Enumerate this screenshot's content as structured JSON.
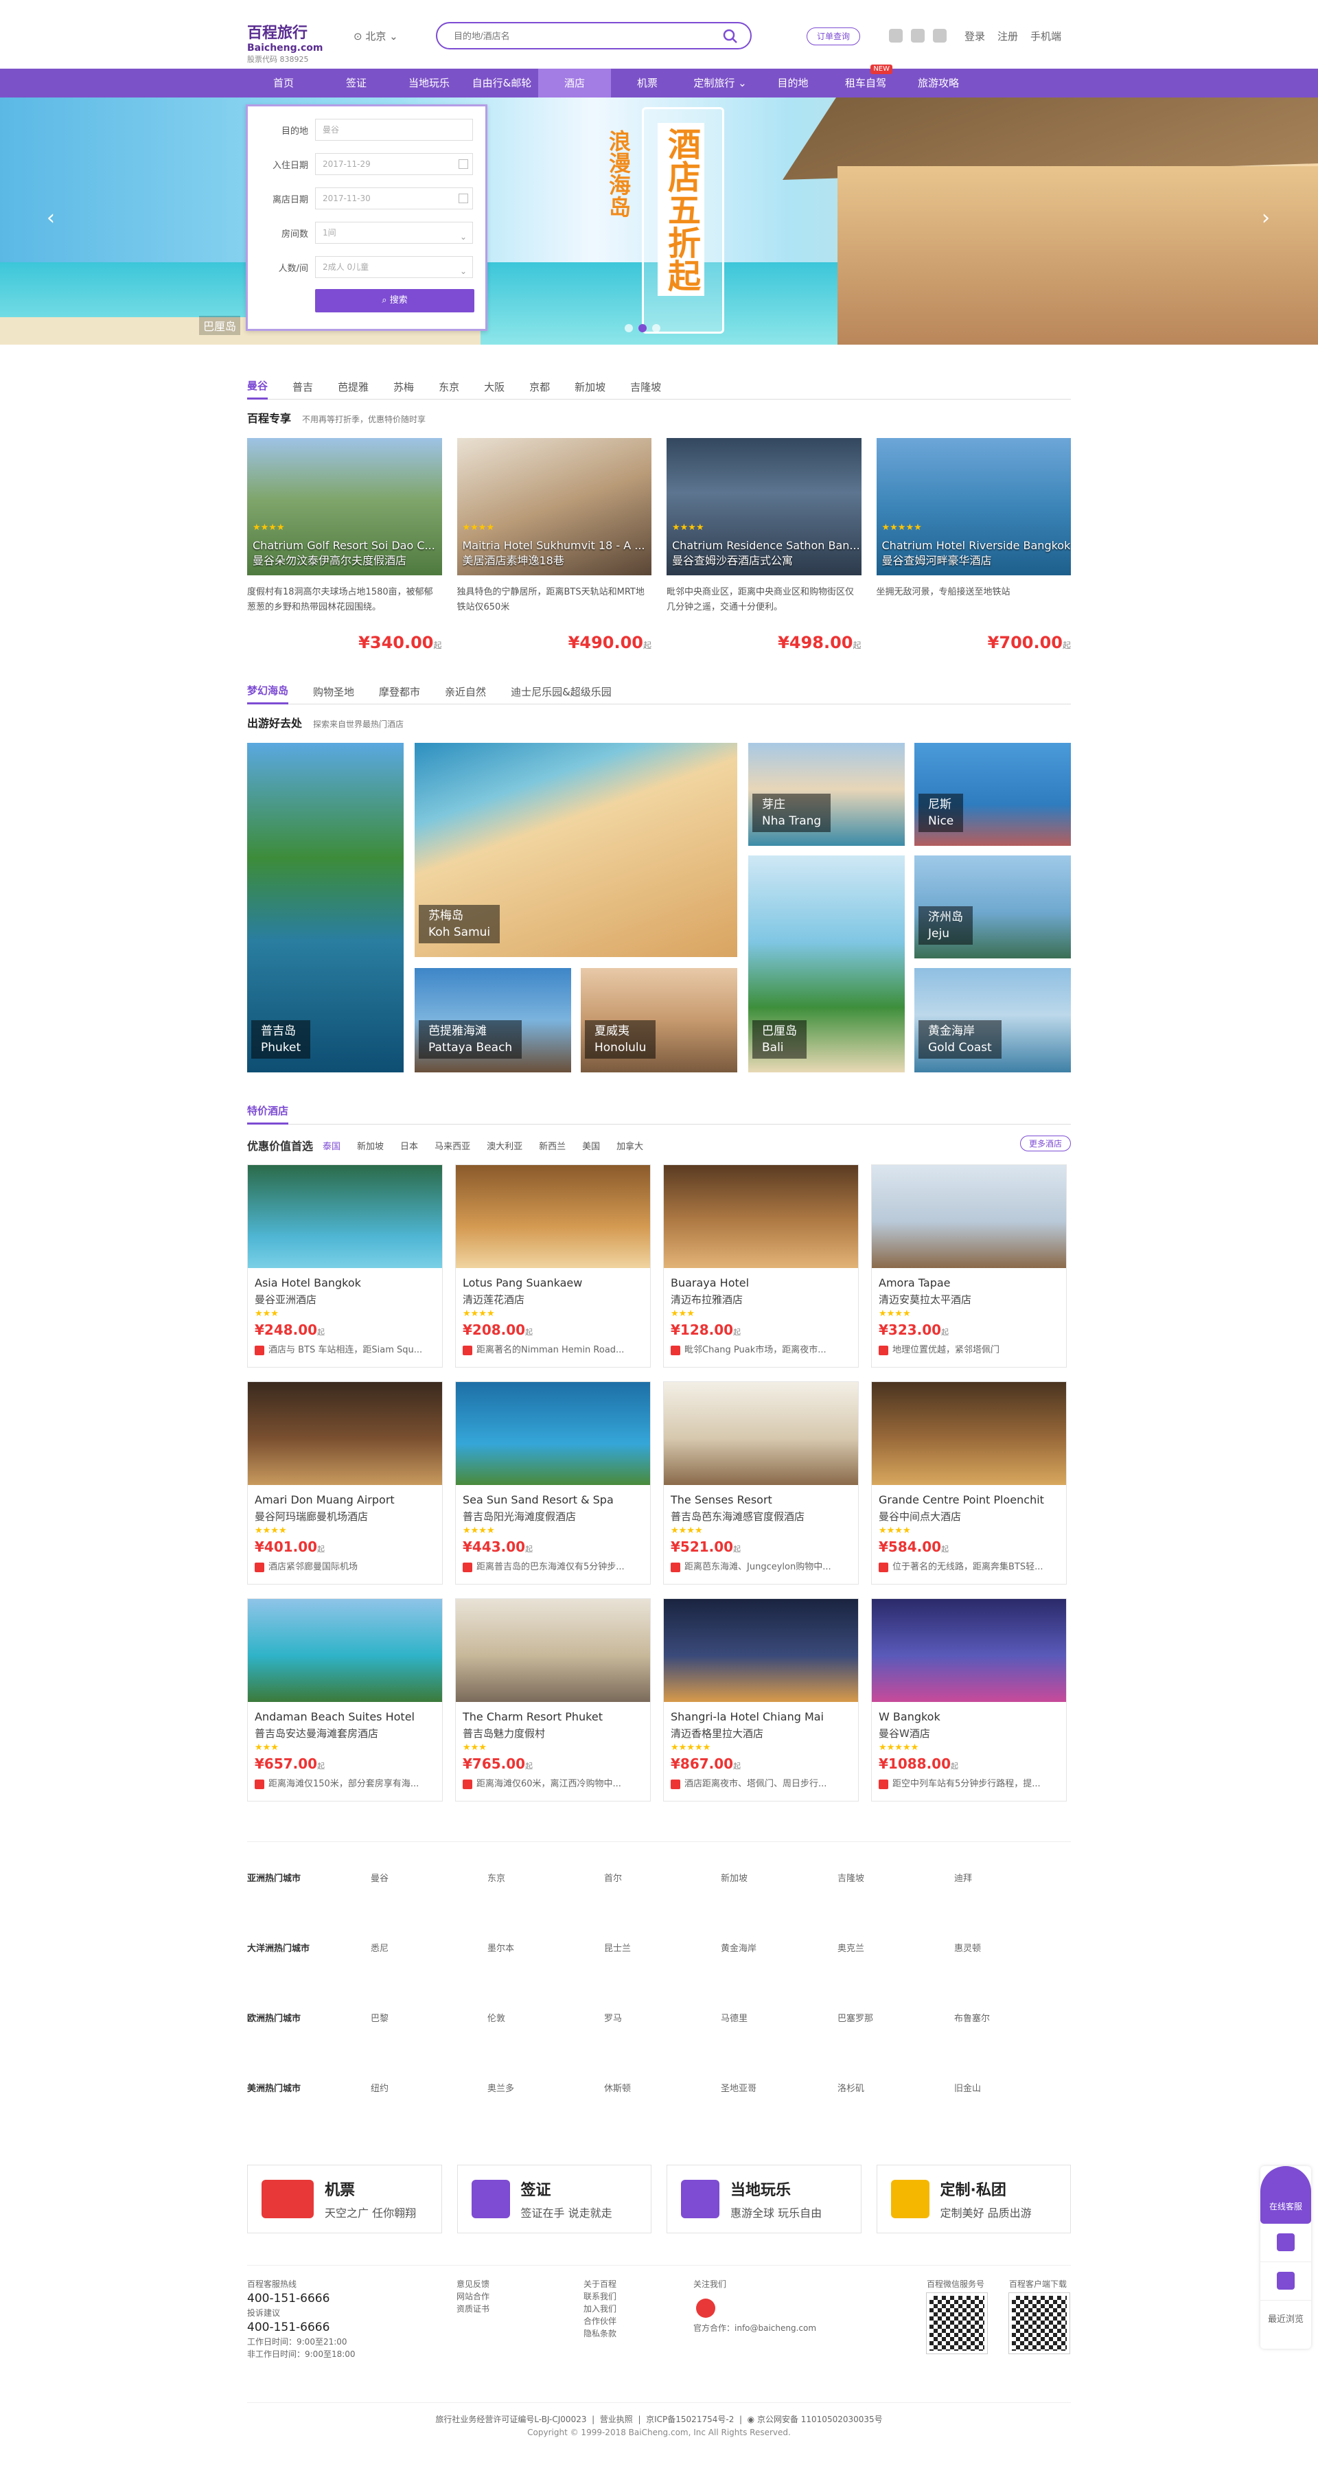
{
  "header": {
    "logo_cn": "百程旅行",
    "logo_en": "Baicheng.com",
    "logo_stock": "股票代码 838925",
    "city": "北京",
    "search_placeholder": "目的地/酒店名",
    "order_query": "订单查询",
    "links": [
      "登录",
      "注册",
      "手机端"
    ]
  },
  "nav": [
    "首页",
    "签证",
    "当地玩乐",
    "自由行&邮轮",
    "酒店",
    "机票",
    "定制旅行",
    "目的地",
    "租车自驾",
    "旅游攻略"
  ],
  "nav_new_tag": "NEW",
  "banner": {
    "slogan": "巴厘岛",
    "poster_small": "浪漫海岛",
    "poster_big": "酒店五折起"
  },
  "booking": {
    "dest_label": "目的地",
    "dest_value": "曼谷",
    "checkin_label": "入住日期",
    "checkin_value": "2017-11-29",
    "checkout_label": "离店日期",
    "checkout_value": "2017-11-30",
    "rooms_label": "房间数",
    "rooms_value": "1间",
    "guests_label": "人数/间",
    "guests_value": "2成人 0儿童",
    "search_btn": "搜索"
  },
  "exclusive": {
    "tabs": [
      "曼谷",
      "普吉",
      "芭提雅",
      "苏梅",
      "东京",
      "大阪",
      "京都",
      "新加坡",
      "吉隆坡"
    ],
    "title": "百程专享",
    "desc": "不用再等打折季，优惠特价随时享",
    "cards": [
      {
        "en": "Chatrium Golf Resort Soi Dao C...",
        "cn": "曼谷朵勿汶泰伊高尔夫度假酒店",
        "desc": "度假村有18洞高尔夫球场占地1580亩，被郁郁葱葱的乡野和热带园林花园围绕。",
        "price": "¥340.00",
        "stars": "★★★★"
      },
      {
        "en": "Maitria Hotel Sukhumvit 18 - A ...",
        "cn": "美居酒店素坤逸18巷",
        "desc": "独具特色的宁静居所，距离BTS天轨站和MRT地铁站仅650米",
        "price": "¥490.00",
        "stars": "★★★★"
      },
      {
        "en": "Chatrium Residence Sathon Ban...",
        "cn": "曼谷查姆沙吞酒店式公寓",
        "desc": "毗邻中央商业区，距离中央商业区和购物街区仅几分钟之遥，交通十分便利。",
        "price": "¥498.00",
        "stars": "★★★★"
      },
      {
        "en": "Chatrium Hotel Riverside Bangkok",
        "cn": "曼谷查姆河畔豪华酒店",
        "desc": "坐拥无敌河景，专船接送至地铁站",
        "price": "¥700.00",
        "stars": "★★★★★"
      }
    ],
    "price_suffix": "起"
  },
  "islands": {
    "tabs": [
      "梦幻海岛",
      "购物圣地",
      "摩登都市",
      "亲近自然",
      "迪士尼乐园&超级乐园"
    ],
    "title": "出游好去处",
    "desc": "探索来自世界最热门酒店",
    "tiles": [
      {
        "cn": "普吉岛",
        "en": "Phuket"
      },
      {
        "cn": "苏梅岛",
        "en": "Koh Samui"
      },
      {
        "cn": "芽庄",
        "en": "Nha Trang"
      },
      {
        "cn": "尼斯",
        "en": "Nice"
      },
      {
        "cn": "巴厘岛",
        "en": "Bali"
      },
      {
        "cn": "济州岛",
        "en": "Jeju"
      },
      {
        "cn": "芭提雅海滩",
        "en": "Pattaya Beach"
      },
      {
        "cn": "夏威夷",
        "en": "Honolulu"
      },
      {
        "cn": "黄金海岸",
        "en": "Gold Coast"
      }
    ]
  },
  "deals": {
    "section_title": "特价酒店",
    "filter_title": "优惠价值首选",
    "countries": [
      "泰国",
      "新加坡",
      "日本",
      "马来西亚",
      "澳大利亚",
      "新西兰",
      "美国",
      "加拿大"
    ],
    "more": "更多酒店",
    "price_suffix": "起",
    "hotels": [
      {
        "en": "Asia Hotel Bangkok",
        "cn": "曼谷亚洲酒店",
        "stars": "★★★",
        "price": "¥248.00",
        "note": "酒店与 BTS 车站相连，距Siam Squ..."
      },
      {
        "en": "Lotus Pang Suankaew",
        "cn": "清迈莲花酒店",
        "stars": "★★★★",
        "price": "¥208.00",
        "note": "距离著名的Nimman Hemin Road..."
      },
      {
        "en": "Buaraya Hotel",
        "cn": "清迈布拉雅酒店",
        "stars": "★★★",
        "price": "¥128.00",
        "note": "毗邻Chang Puak市场，距离夜市..."
      },
      {
        "en": "Amora Tapae",
        "cn": "清迈安莫拉太平酒店",
        "stars": "★★★★",
        "price": "¥323.00",
        "note": "地理位置优越，紧邻塔佩门"
      },
      {
        "en": "Amari Don Muang Airport",
        "cn": "曼谷阿玛瑞廊曼机场酒店",
        "stars": "★★★★",
        "price": "¥401.00",
        "note": "酒店紧邻廊曼国际机场"
      },
      {
        "en": "Sea Sun Sand Resort & Spa",
        "cn": "普吉岛阳光海滩度假酒店",
        "stars": "★★★★",
        "price": "¥443.00",
        "note": "距离普吉岛的巴东海滩仅有5分钟步..."
      },
      {
        "en": "The Senses Resort",
        "cn": "普吉岛芭东海滩感官度假酒店",
        "stars": "★★★★",
        "price": "¥521.00",
        "note": "距离芭东海滩、Jungceylon购物中..."
      },
      {
        "en": "Grande Centre Point Ploenchit",
        "cn": "曼谷中间点大酒店",
        "stars": "★★★★",
        "price": "¥584.00",
        "note": "位于著名的无线路，距离奔集BTS轻..."
      },
      {
        "en": "Andaman Beach Suites Hotel",
        "cn": "普吉岛安达曼海滩套房酒店",
        "stars": "★★★",
        "price": "¥657.00",
        "note": "距离海滩仅150米，部分套房享有海..."
      },
      {
        "en": "The Charm Resort Phuket",
        "cn": "普吉岛魅力度假村",
        "stars": "★★★",
        "price": "¥765.00",
        "note": "距离海滩仅60米，离江西冷购物中..."
      },
      {
        "en": "Shangri-la Hotel Chiang Mai",
        "cn": "清迈香格里拉大酒店",
        "stars": "★★★★★",
        "price": "¥867.00",
        "note": "酒店距离夜市、塔佩门、周日步行..."
      },
      {
        "en": "W Bangkok",
        "cn": "曼谷W酒店",
        "stars": "★★★★★",
        "price": "¥1088.00",
        "note": "距空中列车站有5分钟步行路程，提..."
      }
    ]
  },
  "hot_cities": [
    {
      "region": "亚洲热门城市",
      "cities": [
        "曼谷",
        "东京",
        "首尔",
        "新加坡",
        "吉隆坡",
        "迪拜"
      ]
    },
    {
      "region": "大洋洲热门城市",
      "cities": [
        "悉尼",
        "墨尔本",
        "昆士兰",
        "黄金海岸",
        "奥克兰",
        "惠灵顿"
      ]
    },
    {
      "region": "欧洲热门城市",
      "cities": [
        "巴黎",
        "伦敦",
        "罗马",
        "马德里",
        "巴塞罗那",
        "布鲁塞尔"
      ]
    },
    {
      "region": "美洲热门城市",
      "cities": [
        "纽约",
        "奥兰多",
        "休斯顿",
        "圣地亚哥",
        "洛杉矶",
        "旧金山"
      ]
    }
  ],
  "services": [
    {
      "title": "机票",
      "sub": "天空之广 任你翱翔",
      "color": "#e83838"
    },
    {
      "title": "签证",
      "sub": "签证在手 说走就走",
      "color": "#7d4cd3"
    },
    {
      "title": "当地玩乐",
      "sub": "惠游全球 玩乐自由",
      "color": "#7d4cd3"
    },
    {
      "title": "定制·私团",
      "sub": "定制美好 品质出游",
      "color": "#f5b700"
    }
  ],
  "footer": {
    "hotline_label": "百程客服热线",
    "hotline": "400-151-6666",
    "complaint_label": "投诉建议",
    "complaint": "400-151-6666",
    "hours1": "工作日时间：9:00至21:00",
    "hours2": "非工作日时间：9:00至18:00",
    "col2": [
      "意见反馈",
      "网站合作",
      "资质证书"
    ],
    "col3": [
      "关于百程",
      "联系我们",
      "加入我们",
      "合作伙伴",
      "隐私条款"
    ],
    "follow": "关注我们",
    "weibo": "官方合作：info@baicheng.com",
    "qr1": "百程微信服务号",
    "qr2": "百程客户端下载",
    "license": "旅行社业务经营许可证编号L-BJ-CJ00023",
    "business": "营业执照",
    "icp": "京ICP备15021754号-2",
    "police": "京公网安备 11010502030035号",
    "copyright": "Copyright © 1999-2018 BaiCheng.com, Inc All Rights Reserved."
  },
  "side_widget": {
    "service": "在线客服",
    "recent": "最近浏览"
  }
}
